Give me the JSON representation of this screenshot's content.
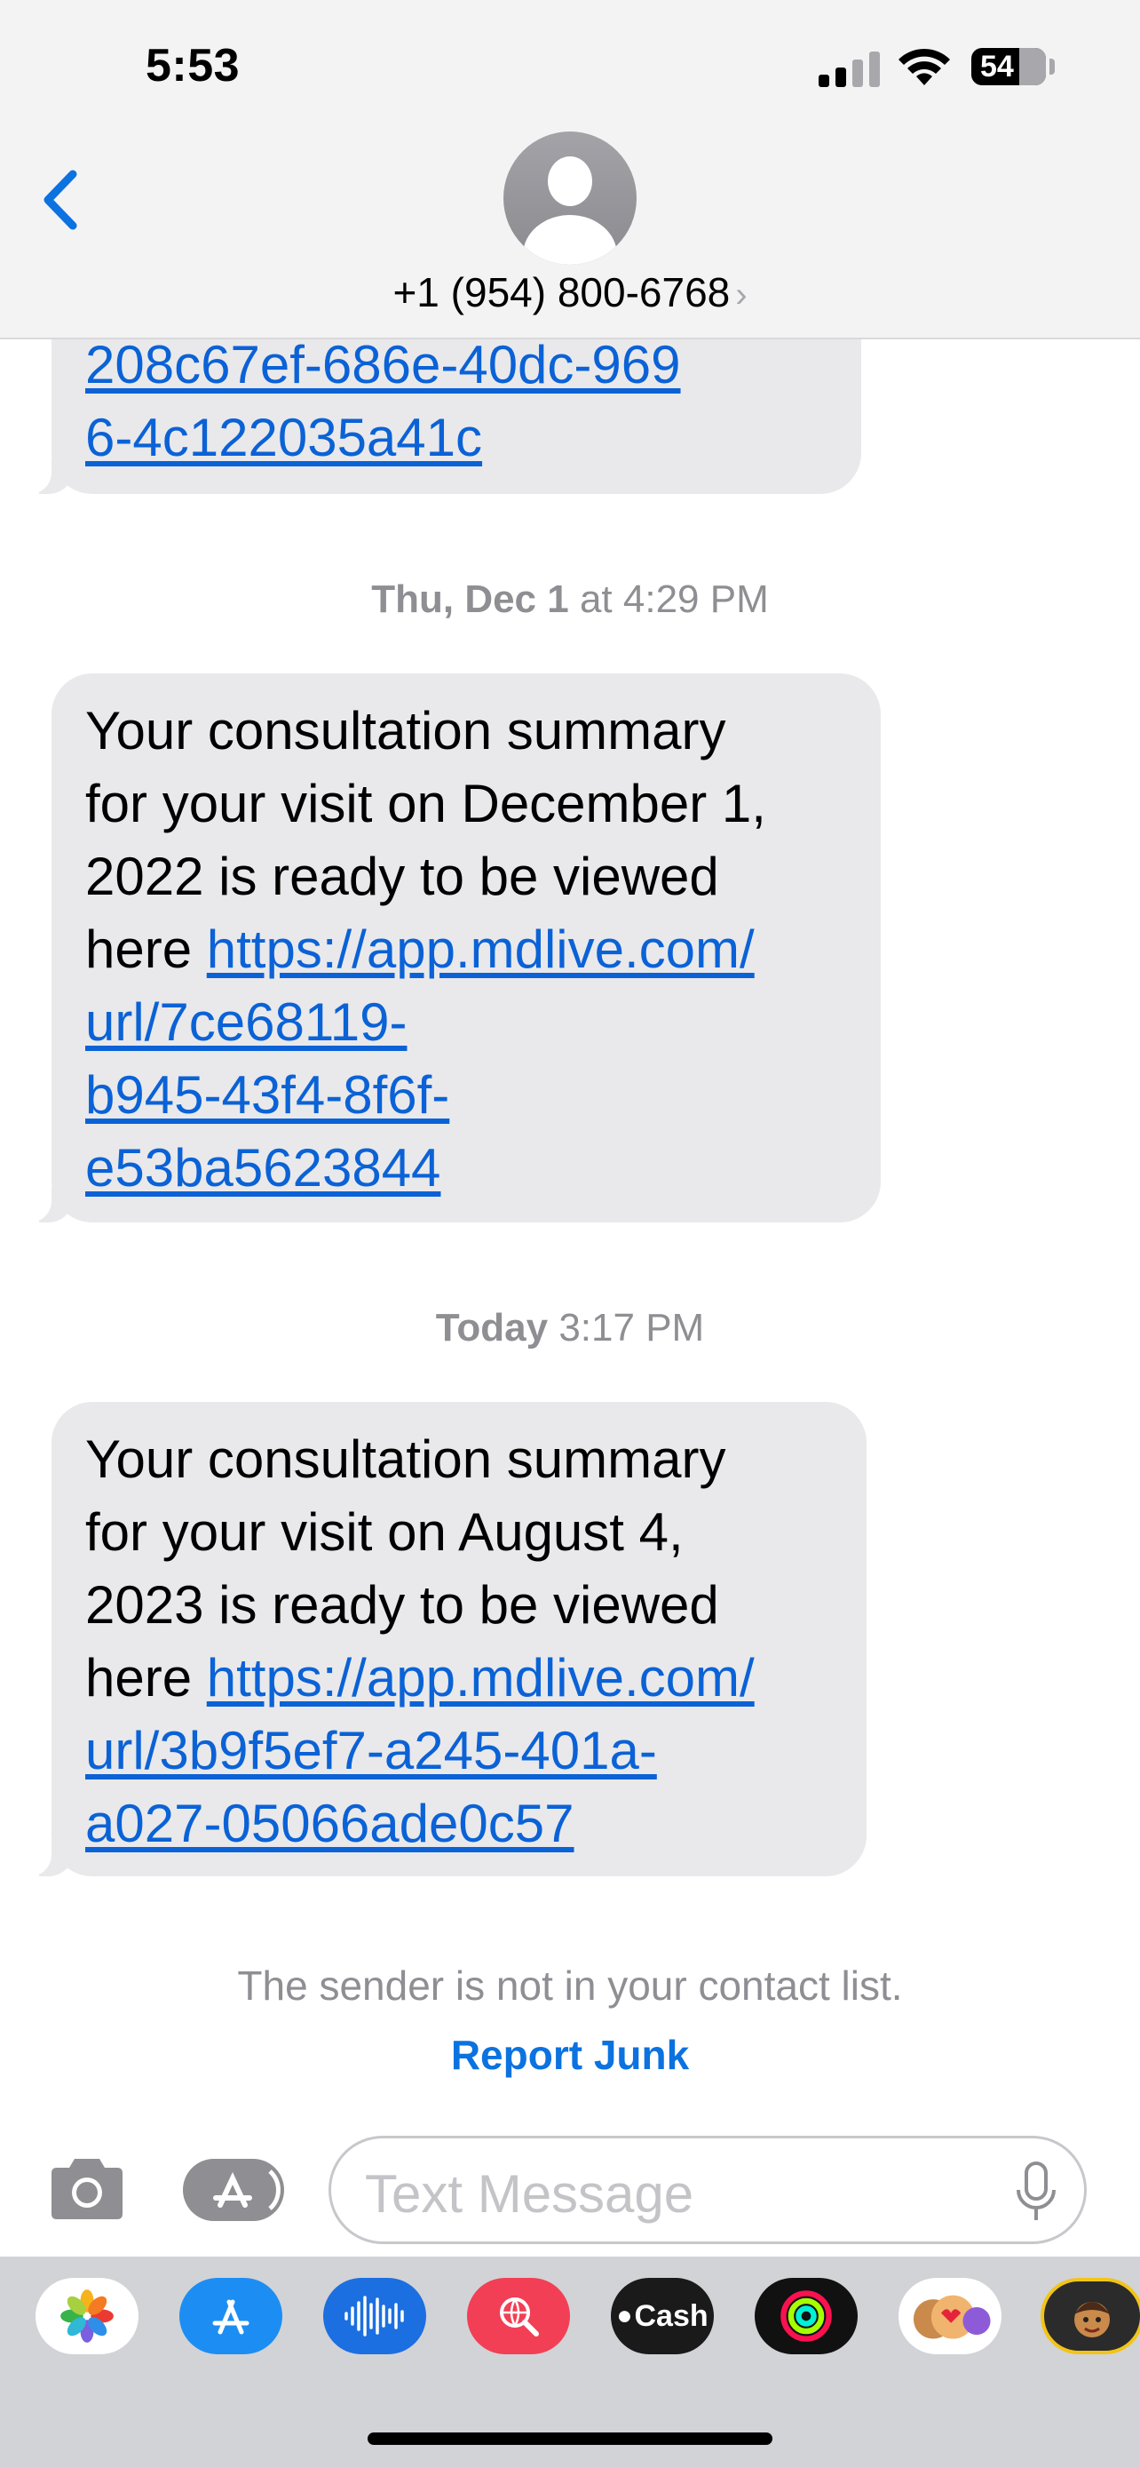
{
  "status_bar": {
    "time": "5:53",
    "battery": "54"
  },
  "header": {
    "contact": "+1 (954) 800-6768",
    "chevron": "›"
  },
  "messages": [
    {
      "type": "received",
      "link_lines": [
        "208c67ef-686e-40dc-969",
        "6-4c122035a41c"
      ]
    },
    {
      "type": "timestamp",
      "day": "Thu, Dec 1",
      "rest": " at 4:29 PM"
    },
    {
      "type": "received",
      "text_lines": [
        "Your consultation summary",
        "for your visit on December  1,",
        "2022 is ready to be viewed",
        "here "
      ],
      "link_lines": [
        "https://app.mdlive.com/",
        "url/7ce68119-",
        "b945-43f4-8f6f-",
        "e53ba5623844"
      ]
    },
    {
      "type": "timestamp",
      "day": "Today",
      "rest": " 3:17 PM"
    },
    {
      "type": "received",
      "text_lines": [
        "Your consultation summary",
        "for your visit on August  4,",
        "2023 is ready to be viewed",
        "here "
      ],
      "link_lines": [
        "https://app.mdlive.com/",
        "url/3b9f5ef7-a245-401a-",
        "a027-05066ade0c57"
      ]
    }
  ],
  "notice": "The sender is not in your contact list.",
  "report_junk": "Report Junk",
  "compose": {
    "placeholder": "Text Message"
  },
  "app_drawer": [
    {
      "name": "photos-app-icon"
    },
    {
      "name": "app-store-icon"
    },
    {
      "name": "audio-message-icon"
    },
    {
      "name": "images-search-icon"
    },
    {
      "name": "apple-cash-icon",
      "label": "Cash"
    },
    {
      "name": "activity-icon"
    },
    {
      "name": "memoji-stickers-icon"
    },
    {
      "name": "memoji-icon"
    }
  ],
  "colors": {
    "bubble": "#e9e9eb",
    "link": "#0b62d6",
    "accent": "#0b72e0",
    "header_bg": "#f3f3f4",
    "drawer_bg": "#d2d3d7"
  }
}
